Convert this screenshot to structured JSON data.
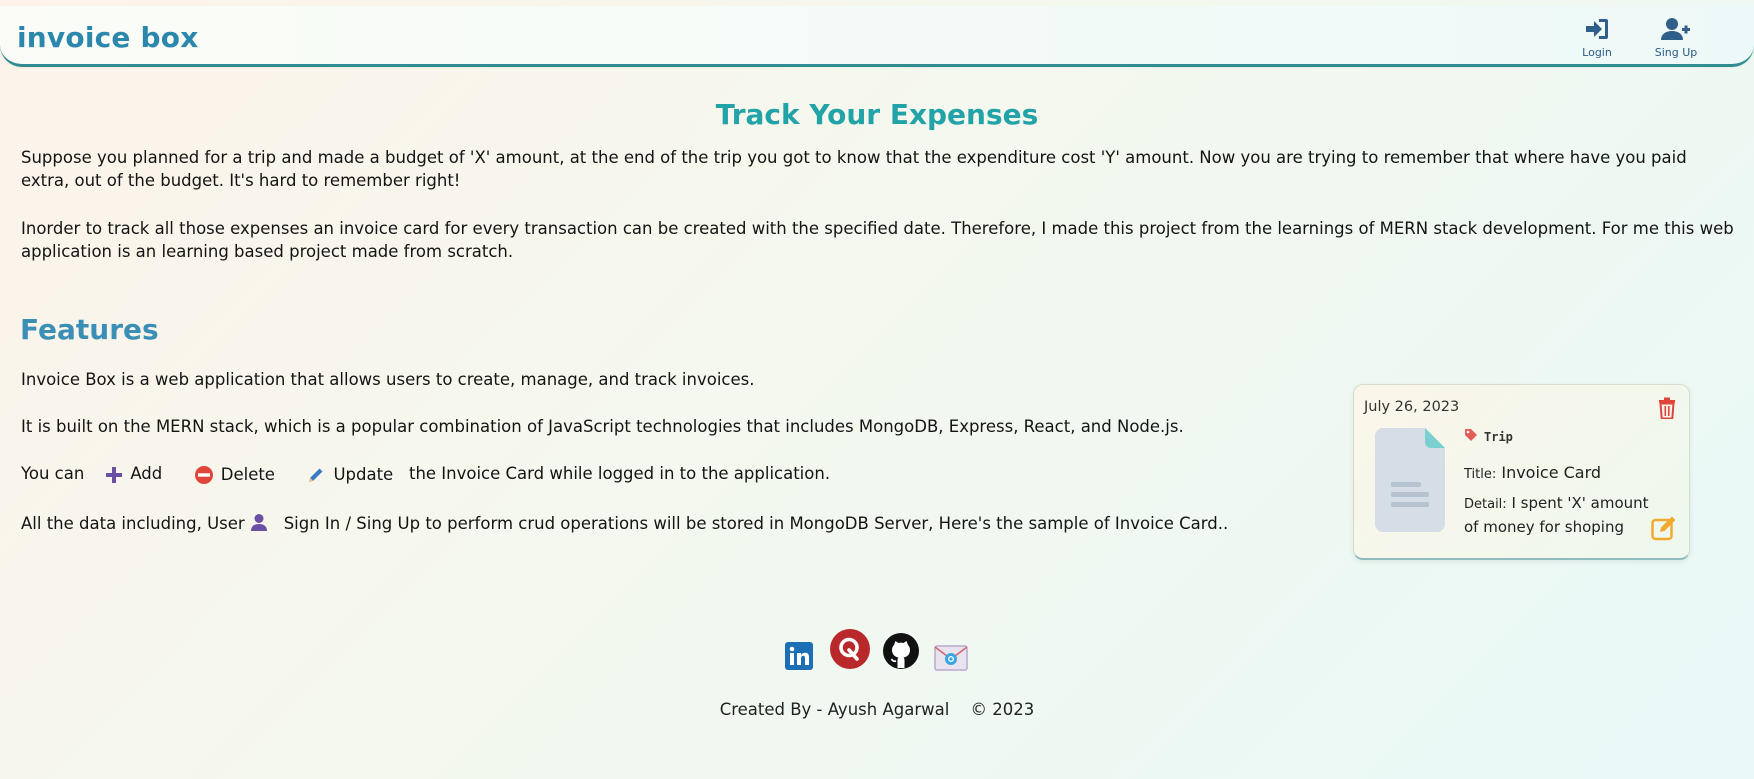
{
  "navbar": {
    "brand": "invoice box",
    "login_label": "Login",
    "signup_label": "Sing Up"
  },
  "intro": {
    "title": "Track Your Expenses",
    "paragraph1": "Suppose you planned for a trip and made a budget of 'X' amount, at the end of the trip you got to know that the expenditure cost 'Y' amount. Now you are trying to remember that where have you paid extra, out of the budget. It's hard to remember right!",
    "paragraph2": "Inorder to track all those expenses an invoice card for every transaction can be created with the specified date. Therefore, I made this project from the learnings of MERN stack development. For me this web application is an learning based project made from scratch."
  },
  "features": {
    "heading": "Features",
    "line1": "Invoice Box is a web application that allows users to create, manage, and track invoices.",
    "line2": "It is built on the MERN stack, which is a popular combination of JavaScript technologies that includes MongoDB, Express, React, and Node.js.",
    "line3_prefix": "You can",
    "add_label": "Add",
    "delete_label": "Delete",
    "update_label": "Update",
    "line3_suffix": "the Invoice Card while logged in to the application.",
    "line4_prefix": "All the data including, User",
    "line4_suffix": "Sign In / Sing Up to perform crud operations will be stored in MongoDB Server, Here's the sample of Invoice Card.."
  },
  "card": {
    "date": "July 26, 2023",
    "tag": "Trip",
    "title_label": "Title:",
    "title_value": "Invoice Card",
    "detail_label": "Detail:",
    "detail_value": "I spent 'X' amount of money for shoping"
  },
  "footer": {
    "created_by": "Created By - Ayush Agarwal",
    "copyright": "© 2023"
  },
  "colors": {
    "accent_teal": "#21a3a8",
    "brand_blue": "#2c87ad",
    "navbar_border": "#2f8d92",
    "delete_red": "#e0443a",
    "edit_orange": "#f2a92f"
  }
}
